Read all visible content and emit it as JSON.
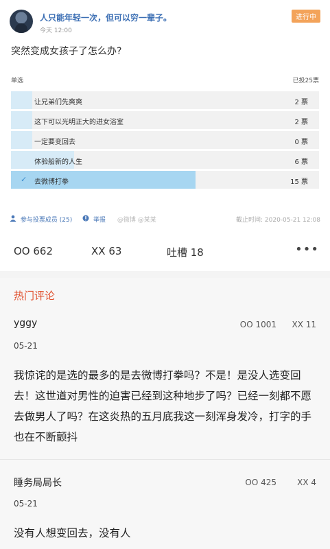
{
  "poll": {
    "poster_name": "人只能年轻一次，但可以穷一辈子。",
    "post_time": "今天 12:00",
    "status": "进行中",
    "question": "突然变成女孩子了怎么办?",
    "type": "单选",
    "total": "已投25票",
    "options": [
      {
        "label": "让兄弟们先爽爽",
        "count": "2 票",
        "share": 0.08,
        "selected": false
      },
      {
        "label": "这下可以光明正大的进女浴室",
        "count": "2 票",
        "share": 0.08,
        "selected": false
      },
      {
        "label": "一定要变回去",
        "count": "0 票",
        "share": 0,
        "selected": false
      },
      {
        "label": "体验船新的人生",
        "count": "6 票",
        "share": 0.24,
        "selected": false
      },
      {
        "label": "去微博打拳",
        "count": "15 票",
        "share": 0.6,
        "selected": true
      }
    ],
    "footer": {
      "participants": "参与投票成员 (25)",
      "report": "举报",
      "watermark": "@微博 @某某",
      "deadline": "截止时间: 2020-05-21 12:08"
    }
  },
  "reactions": {
    "oo": "OO 662",
    "xx": "XX 63",
    "tucao": "吐槽 18",
    "more": "•••"
  },
  "comments_section": {
    "title": "热门评论",
    "items": [
      {
        "user": "yggy",
        "date": "05-21",
        "oo": "OO 1001",
        "xx": "XX 11",
        "text": "我惊诧的是选的最多的是去微博打拳吗？不是！是没人选变回去！这世道对男性的迫害已经到这种地步了吗？已经一刻都不愿去做男人了吗？在这炎热的五月底我这一刻浑身发冷，打字的手也在不断颤抖"
      },
      {
        "user": "睡务局局长",
        "date": "05-21",
        "oo": "OO 425",
        "xx": "XX 4",
        "text": "没有人想变回去，没有人"
      }
    ]
  }
}
